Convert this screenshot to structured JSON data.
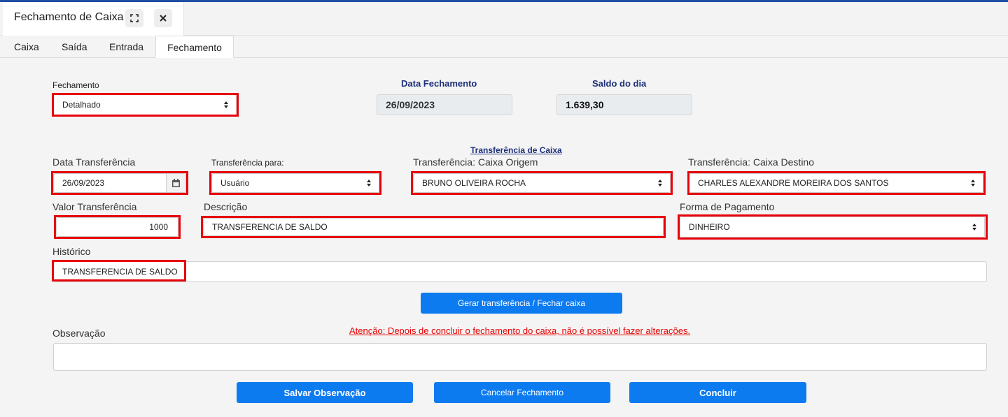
{
  "window": {
    "title": "Fechamento de Caixa",
    "expand_icon": "expand-icon",
    "close_icon": "close-icon"
  },
  "tabs": [
    {
      "label": "Caixa"
    },
    {
      "label": "Saída"
    },
    {
      "label": "Entrada"
    },
    {
      "label": "Fechamento"
    }
  ],
  "fechamento": {
    "label": "Fechamento",
    "value": "Detalhado"
  },
  "data_fechamento": {
    "label": "Data Fechamento",
    "value": "26/09/2023"
  },
  "saldo_dia": {
    "label": "Saldo do dia",
    "value": "1.639,30"
  },
  "transferencia_link": "Transferência de Caixa",
  "data_transferencia": {
    "label": "Data Transferência",
    "value": "26/09/2023"
  },
  "transferencia_para": {
    "label": "Transferência para:",
    "value": "Usuário"
  },
  "caixa_origem": {
    "label": "Transferência: Caixa Origem",
    "value": "BRUNO OLIVEIRA ROCHA"
  },
  "caixa_destino": {
    "label": "Transferência: Caixa Destino",
    "value": "CHARLES ALEXANDRE MOREIRA DOS SANTOS"
  },
  "valor_transferencia": {
    "label": "Valor Transferência",
    "value": "1000"
  },
  "descricao": {
    "label": "Descrição",
    "value": "TRANSFERENCIA DE SALDO"
  },
  "forma_pagamento": {
    "label": "Forma de Pagamento",
    "value": "DINHEIRO"
  },
  "historico": {
    "label": "Histórico",
    "value": "TRANSFERENCIA DE SALDO"
  },
  "gerar_button": "Gerar transferência / Fechar caixa",
  "warning": "Atenção: Depois de concluir o fechamento do caixa, não é possível fazer alterações.",
  "observacao": {
    "label": "Observação",
    "value": ""
  },
  "buttons": {
    "salvar": "Salvar Observação",
    "cancelar": "Cancelar Fechamento",
    "concluir": "Concluir"
  },
  "colors": {
    "accent": "#0d7bf0",
    "highlight": "#e8000a",
    "header_blue": "#1c2f7a",
    "warning": "#e80000"
  }
}
